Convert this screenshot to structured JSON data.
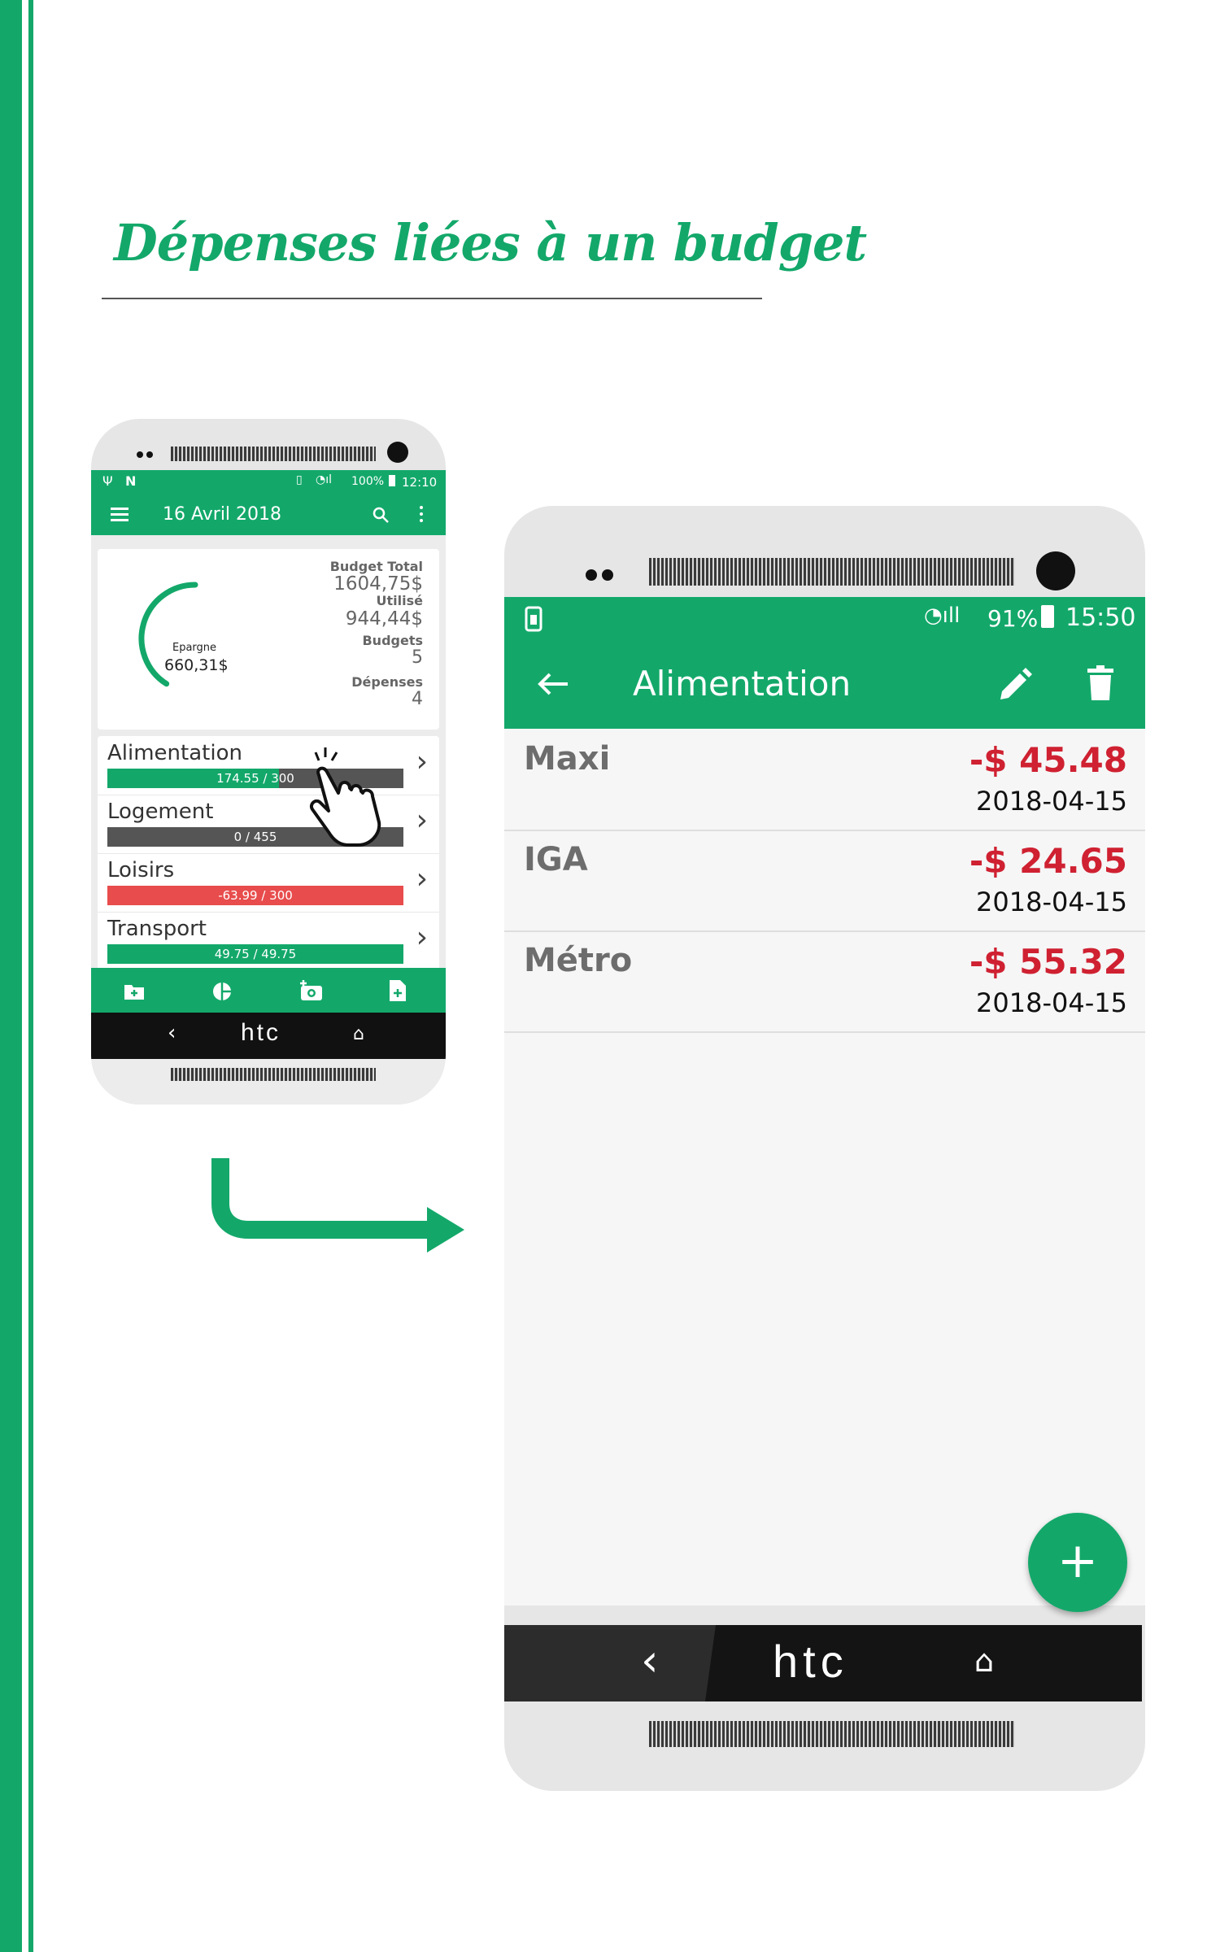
{
  "page_title": "Dépenses liées à un budget",
  "colors": {
    "accent": "#13a86a",
    "negative": "#cf2131",
    "bar_grey": "#555555",
    "bar_red": "#e84c4c"
  },
  "home_screen": {
    "status_bar": {
      "battery": "100%",
      "time": "12:10"
    },
    "app_bar": {
      "title": "16 Avril 2018",
      "menu_icon": "hamburger-icon",
      "search_icon": "search-icon",
      "more_icon": "more-vert-icon"
    },
    "summary": {
      "savings_label": "Epargne",
      "savings_value": "660,31$",
      "savings_fraction": 0.41,
      "budget_total_label": "Budget Total",
      "budget_total_value": "1604,75$",
      "used_label": "Utilisé",
      "used_value": "944,44$",
      "budgets_label": "Budgets",
      "budgets_value": "5",
      "expenses_label": "Dépenses",
      "expenses_value": "4"
    },
    "categories": [
      {
        "label": "Alimentation",
        "value_text": "174.55 / 300",
        "fraction": 0.58,
        "fill": "green"
      },
      {
        "label": "Logement",
        "value_text": "0 / 455",
        "fraction": 0,
        "fill": "green"
      },
      {
        "label": "Loisirs",
        "value_text": "-63.99 / 300",
        "fraction": 1,
        "fill": "red"
      },
      {
        "label": "Transport",
        "value_text": "49.75 / 49.75",
        "fraction": 1,
        "fill": "green"
      }
    ],
    "bottom_nav_icons": [
      "add-folder-icon",
      "pie-chart-icon",
      "add-photo-icon",
      "add-file-icon"
    ],
    "nav_brand": "htc"
  },
  "detail_screen": {
    "status_bar": {
      "battery": "91%",
      "time": "15:50"
    },
    "app_bar": {
      "title": "Alimentation",
      "back_icon": "arrow-back-icon",
      "edit_icon": "edit-pencil-icon",
      "delete_icon": "trash-icon"
    },
    "transactions": [
      {
        "name": "Maxi",
        "amount": "-$ 45.48",
        "date": "2018-04-15"
      },
      {
        "name": "IGA",
        "amount": "-$ 24.65",
        "date": "2018-04-15"
      },
      {
        "name": "Métro",
        "amount": "-$ 55.32",
        "date": "2018-04-15"
      }
    ],
    "fab_label": "+",
    "nav_brand": "htc"
  }
}
